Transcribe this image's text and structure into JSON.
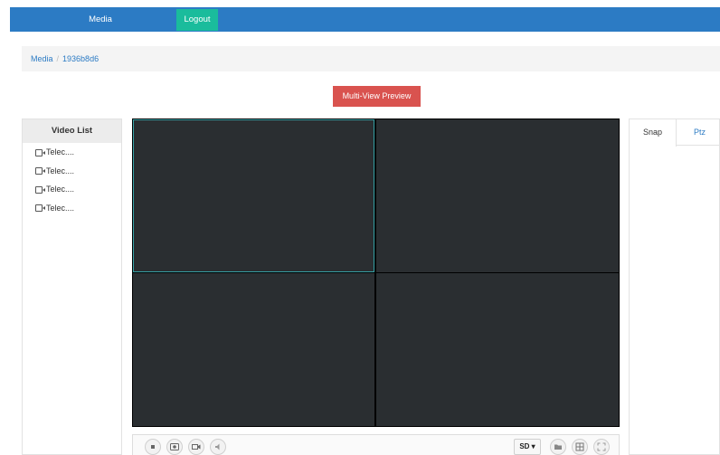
{
  "navbar": {
    "media_label": "Media",
    "logout_label": "Logout",
    "colors": {
      "bar": "#2c7bc4",
      "logout": "#1abc9c"
    }
  },
  "breadcrumb": {
    "root": "Media",
    "separator": "/",
    "current": "1936b8d6"
  },
  "preview_button": {
    "label": "Multi-View Preview",
    "color": "#d9534f"
  },
  "video_list": {
    "title": "Video List",
    "items": [
      {
        "label": "Telec....",
        "icon": "camera-icon"
      },
      {
        "label": "Telec....",
        "icon": "camera-icon"
      },
      {
        "label": "Telec....",
        "icon": "camera-icon"
      },
      {
        "label": "Telec....",
        "icon": "camera-icon"
      }
    ]
  },
  "video_grid": {
    "cells": 4,
    "selected_index": 0,
    "selected_border_color": "#36a2a6"
  },
  "controls": {
    "left": [
      "stop-icon",
      "snapshot-icon",
      "record-icon",
      "mute-icon"
    ],
    "quality_label": "SD",
    "right": [
      "folder-icon",
      "layout-grid-icon",
      "fullscreen-icon"
    ]
  },
  "right_panel": {
    "tabs": [
      {
        "label": "Snap",
        "active": true
      },
      {
        "label": "Ptz",
        "active": false
      }
    ]
  }
}
